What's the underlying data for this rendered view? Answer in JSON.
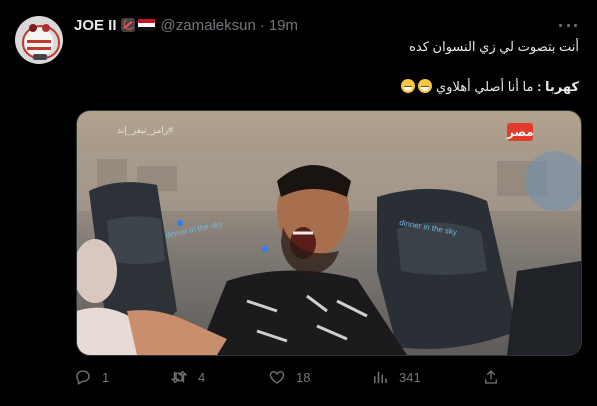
{
  "user": {
    "display_name": "JOE II",
    "handle": "@zamaleksun",
    "time": "19m",
    "badges": [
      "archery-icon",
      "egypt-flag-icon"
    ]
  },
  "tweet": {
    "line1": "أنت بتصوت لي زي النسوان كده",
    "line2_bold": "كهربا :",
    "line2_rest": " ما أنا أصلي أهلاوي",
    "emoji": "grinning-face-icon"
  },
  "media": {
    "hashtag_overlay": "#رامز_نيفر_إند",
    "channel_logo": "مصر",
    "seat_label_left": "dinner in the sky",
    "seat_label_right": "dinner in the sky"
  },
  "actions": {
    "reply_count": "1",
    "retweet_count": "4",
    "like_count": "18",
    "views_count": "341"
  },
  "colors": {
    "background": "#000000",
    "text": "#e7e9ea",
    "muted": "#71767b",
    "flag_red": "#ce1126",
    "accent_seat_text": "#6fb8d9"
  }
}
